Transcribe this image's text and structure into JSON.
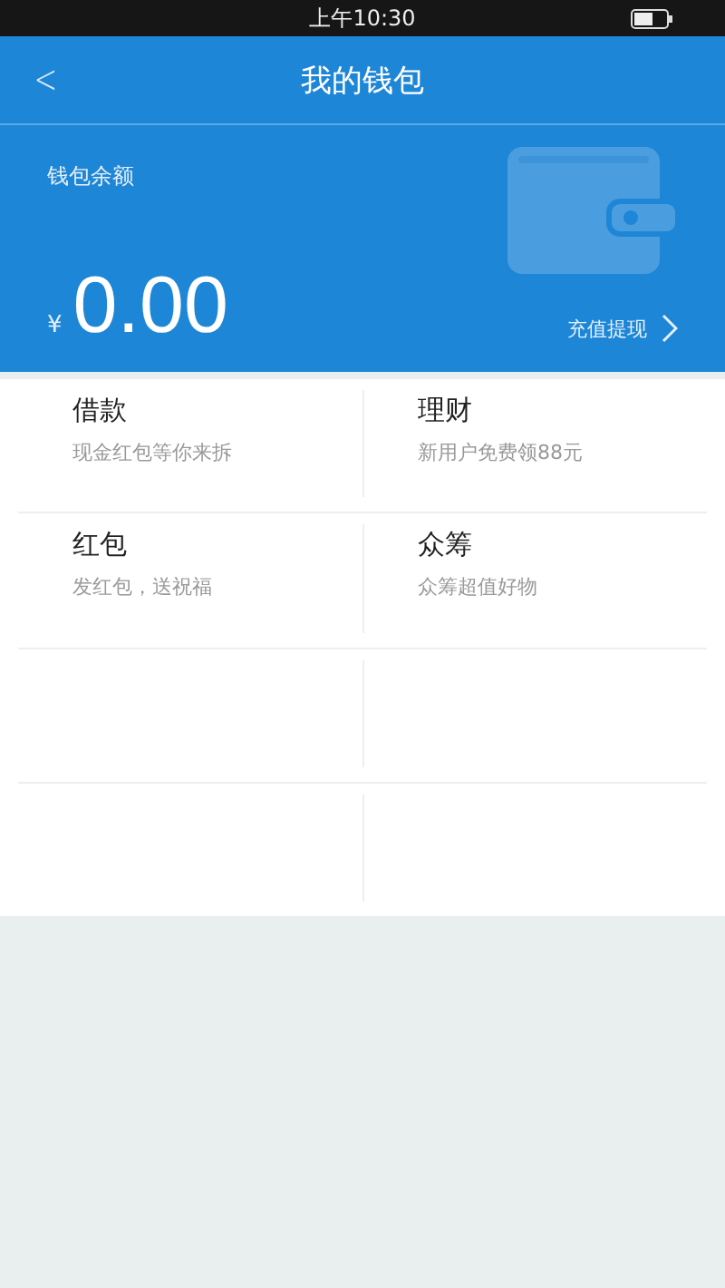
{
  "status_bar": {
    "time": "上午10:30"
  },
  "header": {
    "back": "<",
    "title": "我的钱包"
  },
  "balance": {
    "label": "钱包余额",
    "currency": "¥",
    "amount": "0.00",
    "action": "充值提现"
  },
  "services": [
    {
      "title": "借款",
      "subtitle": "现金红包等你来拆"
    },
    {
      "title": "理财",
      "subtitle": "新用户免费领88元"
    },
    {
      "title": "红包",
      "subtitle": "发红包，送祝福"
    },
    {
      "title": "众筹",
      "subtitle": "众筹超值好物"
    }
  ]
}
